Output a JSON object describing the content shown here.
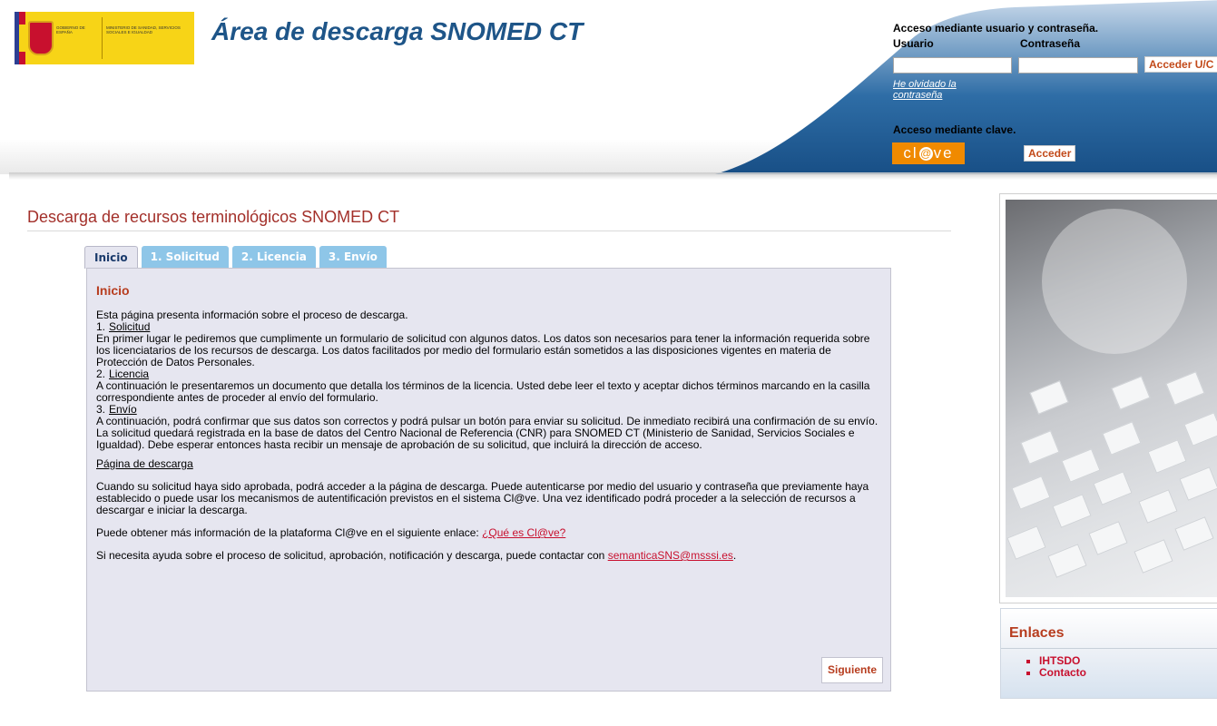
{
  "header": {
    "site_title": "Área de descarga SNOMED CT",
    "logo": {
      "gov_text": "GOBIERNO DE ESPAÑA",
      "ministry_text": "MINISTERIO DE SANIDAD, SERVICIOS SOCIALES E IGUALDAD"
    }
  },
  "login": {
    "heading": "Acceso mediante usuario y contraseña.",
    "user_label": "Usuario",
    "password_label": "Contraseña",
    "user_value": "",
    "password_value": "",
    "submit_label": "Acceder U/C",
    "forgot_link": "He olvidado la contraseña",
    "clave_heading": "Acceso mediante clave.",
    "clave_logo_text": "cl@ve",
    "clave_button": "Acceder"
  },
  "main": {
    "page_heading": "Descarga de recursos terminológicos SNOMED CT",
    "tabs": [
      {
        "label": "Inicio",
        "active": true
      },
      {
        "label": "1. Solicitud",
        "active": false
      },
      {
        "label": "2. Licencia",
        "active": false
      },
      {
        "label": "3. Envío",
        "active": false
      }
    ],
    "section_title": "Inicio",
    "intro": "Esta página presenta información sobre el proceso de descarga.",
    "steps": [
      {
        "num": "1.",
        "title": "Solicitud",
        "body": "En primer lugar le pediremos que cumplimente un formulario de solicitud con algunos datos. Los datos son necesarios para tener la información requerida sobre los licenciatarios de los recursos de descarga. Los datos facilitados por medio del formulario están sometidos a las disposiciones vigentes en materia de Protección de Datos Personales."
      },
      {
        "num": "2.",
        "title": "Licencia",
        "body": "A continuación le presentaremos un documento que detalla los términos de la licencia. Usted debe leer el texto y aceptar dichos términos marcando en la casilla correspondiente antes de proceder al envío del formulario."
      },
      {
        "num": "3.",
        "title": "Envío",
        "body": "A continuación, podrá confirmar que sus datos son correctos y podrá pulsar un botón para enviar su solicitud. De inmediato recibirá una confirmación de su envío. La solicitud quedará registrada en la base de datos del Centro Nacional de Referencia (CNR) para SNOMED CT (Ministerio de Sanidad, Servicios Sociales e Igualdad). Debe esperar entonces hasta recibir un mensaje de aprobación de su solicitud, que incluirá la dirección de acceso."
      }
    ],
    "download_heading": "Página de descarga",
    "download_body": "Cuando su solicitud haya sido aprobada, podrá acceder a la página de descarga. Puede autenticarse por medio del usuario y contraseña que previamente haya establecido o puede usar los mecanismos de autentificación previstos en el sistema Cl@ve. Una vez identificado podrá proceder a la selección de recursos a descargar e iniciar la descarga.",
    "clave_info_text": "Puede obtener más información de la plataforma Cl@ve en el siguiente enlace: ",
    "clave_info_link": "¿Qué es Cl@ve?",
    "help_text": "Si necesita ayuda sobre el proceso de solicitud, aprobación, notificación y descarga, puede contactar con ",
    "help_email": "semanticaSNS@msssi.es",
    "help_suffix": ".",
    "next_button": "Siguiente"
  },
  "sidebar": {
    "links_heading": "Enlaces",
    "links": [
      {
        "label": "IHTSDO"
      },
      {
        "label": "Contacto"
      }
    ]
  }
}
